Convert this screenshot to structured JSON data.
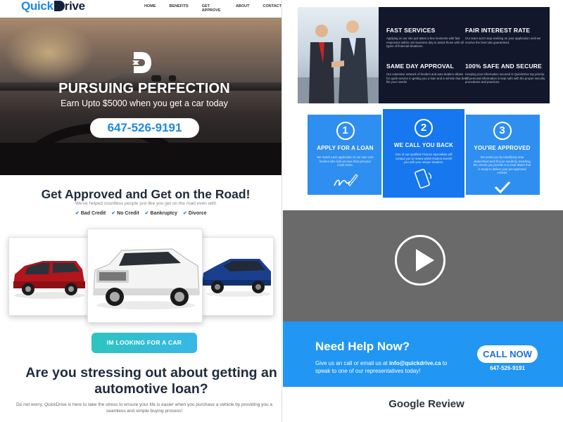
{
  "brand": {
    "logo_first": "Quick",
    "logo_rest": "rive"
  },
  "nav": {
    "items": [
      "HOME",
      "BENEFITS",
      "GET APPROVE",
      "ABOUT",
      "CONTACT"
    ]
  },
  "hero": {
    "title": "PURSUING PERFECTION",
    "subtitle": "Earn Upto $5000 when you get a car today",
    "phone": "647-526-9191"
  },
  "approved": {
    "title": "Get Approved and Get on the Road!",
    "subtitle": "We've helped countless people just like you get on the road even with",
    "checks": [
      "Bad Credit",
      "No Credit",
      "Bankruptcy",
      "Divorce"
    ]
  },
  "cars": [
    "red-minivan",
    "white-suv",
    "blue-sedan"
  ],
  "cta": {
    "label": "IM LOOKING FOR A CAR"
  },
  "stress": {
    "title": "Are you stressing out about getting an automotive loan?",
    "text": "Do not worry, QuickDrive is here to take the stress to ensure your life is easier when you purchase a vehicle by providing you a seamless and simple buying process!"
  },
  "features": [
    {
      "title": "FAST SERVICES",
      "text": "Applying on our site just takes a few moments with fast responses within one business day to assist those with all types of financial situations."
    },
    {
      "title": "FAIR INTEREST RATE",
      "text": "Our team won't stop working on your application until we receive the best rate guaranteed."
    },
    {
      "title": "SAME DAY APPROVAL",
      "text": "Our extensive network of lenders and auto dealers allows for quick service in getting you a loan and a vehicle that best fits your needs!"
    },
    {
      "title": "100% SAFE AND SECURE",
      "text": "Keeping your information secured is QuickDrive top priority. All personal information is kept safe with the proper security procedures and practices."
    }
  ],
  "steps": [
    {
      "number": "1",
      "title": "APPLY FOR A LOAN",
      "text": "We match each application to our own core lenders who look at more than just your credit score.",
      "icon": "signature-icon"
    },
    {
      "number": "2",
      "title": "WE CALL YOU BACK",
      "text": "One of our qualified Finance Specialists will contact you to review which lenders benefit you with your unique situation.",
      "icon": "phone-icon"
    },
    {
      "number": "3",
      "title": "YOU'RE APPROVED",
      "text": "We assist you by identifying what dealerships best fit your needs by matching the criteria you provide to a local dealer that is ready to deliver your pre-approved vehicle!",
      "icon": "checkmark-icon"
    }
  ],
  "help": {
    "title": "Need Help Now?",
    "text_before": "Give us an call or email us at ",
    "email": "info@quickdrive.ca",
    "text_after": " to speak to one of our representatives today!",
    "button": "CALL NOW",
    "phone": "647-526-9191"
  },
  "google": {
    "title": "Google Review"
  },
  "colors": {
    "brand_blue": "#1e88e5",
    "navy": "#12213a",
    "step_blue": "#2f8ff0",
    "help_blue": "#2196f3"
  }
}
